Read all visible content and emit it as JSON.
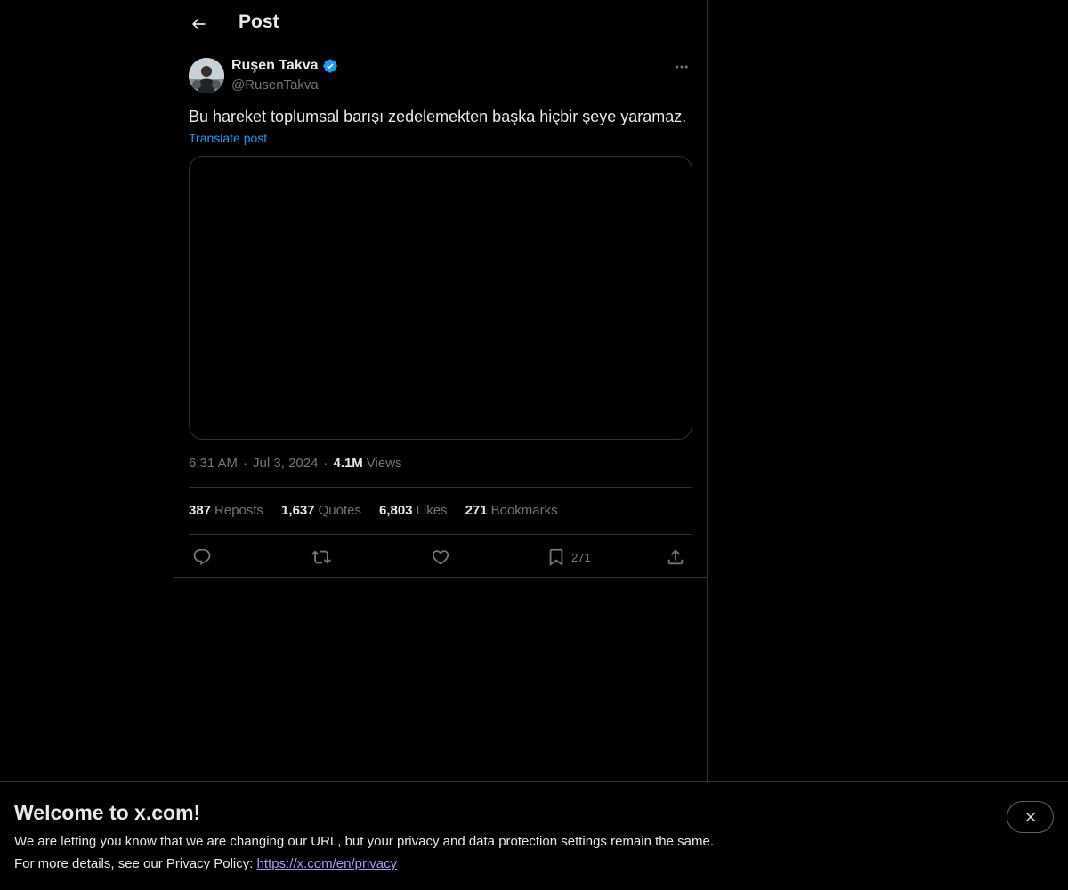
{
  "header": {
    "title": "Post"
  },
  "author": {
    "display_name": "Ruşen Takva",
    "handle": "@RusenTakva",
    "verified": true
  },
  "post": {
    "text": "Bu hareket toplumsal barışı zedelemekten başka hiçbir şeye yaramaz.",
    "translate_label": "Translate post",
    "time": "6:31 AM",
    "date": "Jul 3, 2024",
    "views_count": "4.1M",
    "views_label": "Views"
  },
  "stats": {
    "reposts": {
      "count": "387",
      "label": "Reposts"
    },
    "quotes": {
      "count": "1,637",
      "label": "Quotes"
    },
    "likes": {
      "count": "6,803",
      "label": "Likes"
    },
    "bookmarks": {
      "count": "271",
      "label": "Bookmarks"
    }
  },
  "actions": {
    "bookmark_count": "271"
  },
  "banner": {
    "title": "Welcome to x.com!",
    "line1": "We are letting you know that we are changing our URL, but your privacy and data protection settings remain the same.",
    "line2_prefix": "For more details, see our Privacy Policy: ",
    "link": "https://x.com/en/privacy"
  },
  "colors": {
    "background": "#000000",
    "text_primary": "#e7e9ea",
    "text_secondary": "#71767b",
    "accent_blue": "#1d9bf0",
    "border": "#2f3336",
    "link_visited": "#a59cf5"
  },
  "icons": [
    "arrow-left-icon",
    "verified-badge-icon",
    "more-horizontal-icon",
    "reply-icon",
    "repost-icon",
    "like-icon",
    "bookmark-icon",
    "share-icon",
    "close-icon"
  ]
}
